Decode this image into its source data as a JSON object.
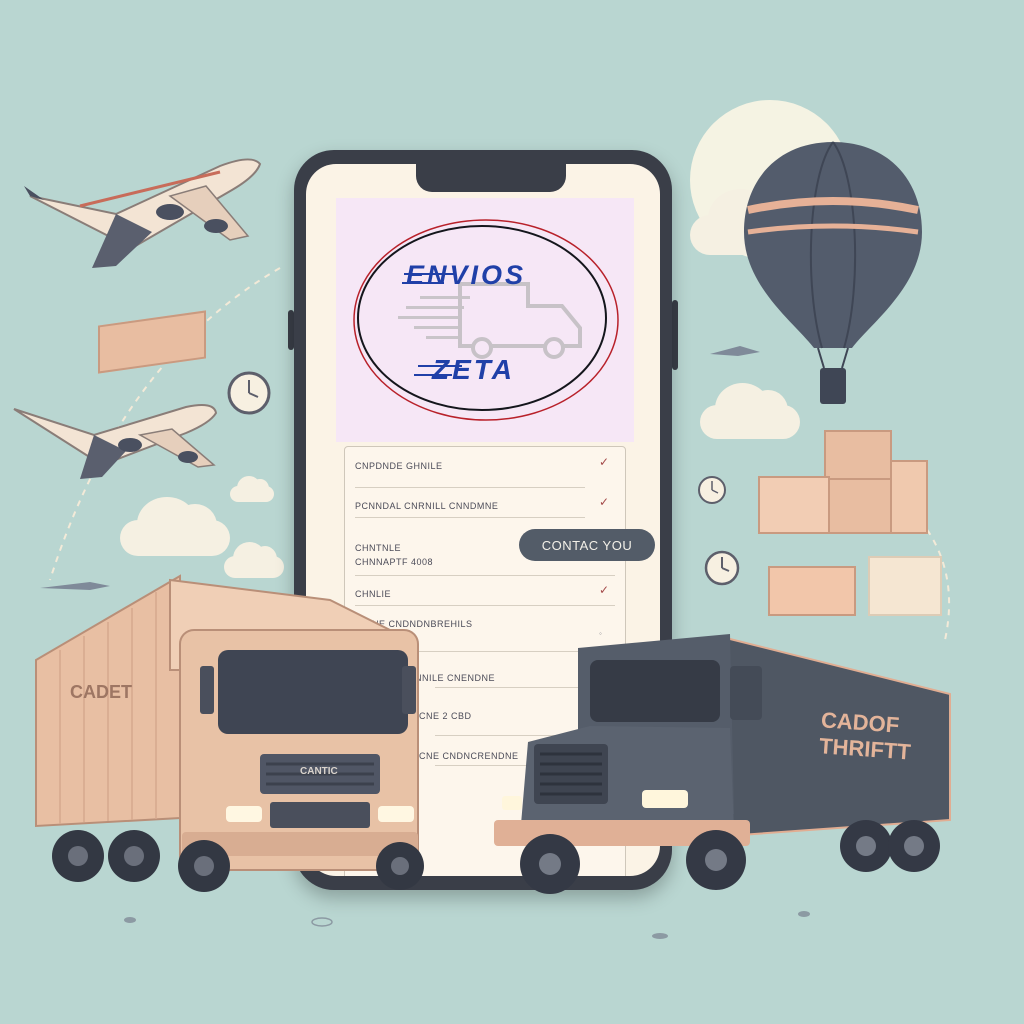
{
  "logo": {
    "line1": "ENVIOS",
    "line2": "ZETA"
  },
  "list": {
    "rows": [
      {
        "label": "CNPDNDE GHNILE"
      },
      {
        "label": "PCNNDAL CNRNILL CNNDMNE"
      },
      {
        "label": "CHNTNLE\nCHNNAPTF 4008"
      },
      {
        "label": "CHNLIE"
      },
      {
        "label": "C CNE CNDNDNBREHILS"
      },
      {
        "label": "CHNNILE CNENDNE"
      },
      {
        "label": "CNE 2 CBD"
      },
      {
        "label": "CNE CNDNCRENDNE"
      }
    ],
    "contact_button": "CONTAC YOU"
  },
  "trucks": {
    "left_trailer": "CADET",
    "left_grille": "CANTIC",
    "right_trailer": "CADOF THRIFTT"
  },
  "colors": {
    "background": "#b9d6d1",
    "phone": "#3a3e48",
    "screen": "#fbf3e6",
    "logo_blue": "#2040a8",
    "truck_left": "#e8c2a6",
    "truck_right": "#4f5763"
  }
}
